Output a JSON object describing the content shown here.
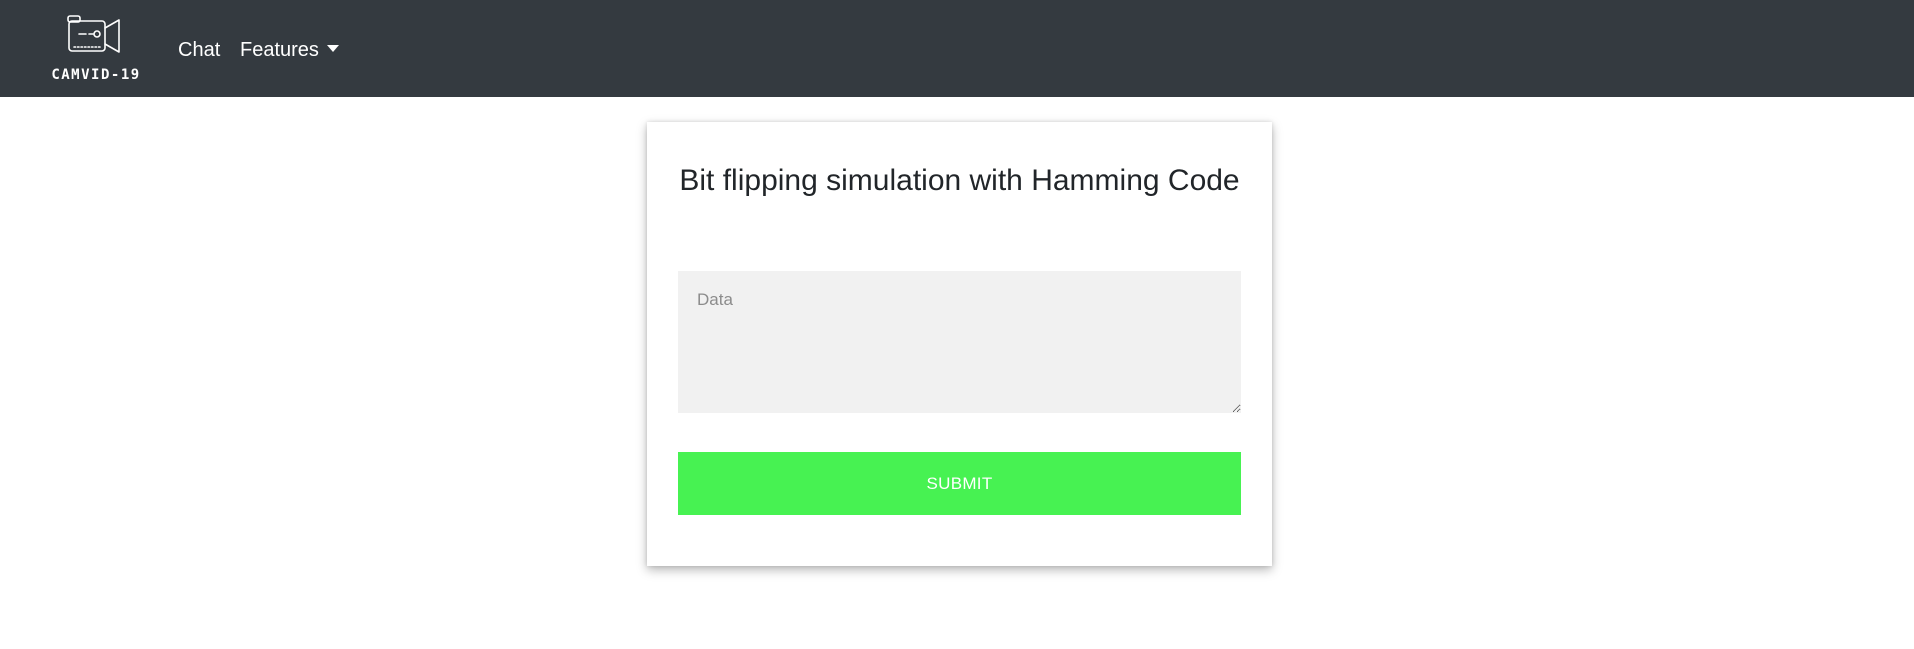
{
  "navbar": {
    "brand": {
      "text": "CAMVID-19",
      "icon": "camera-icon"
    },
    "links": {
      "chat": "Chat",
      "features": "Features"
    }
  },
  "card": {
    "title": "Bit flipping simulation with Hamming Code",
    "data_field": {
      "placeholder": "Data",
      "value": ""
    },
    "submit_label": "SUBMIT"
  },
  "colors": {
    "navbar_bg": "#343a40",
    "submit_bg": "#47f252",
    "input_bg": "#f1f1f1"
  }
}
